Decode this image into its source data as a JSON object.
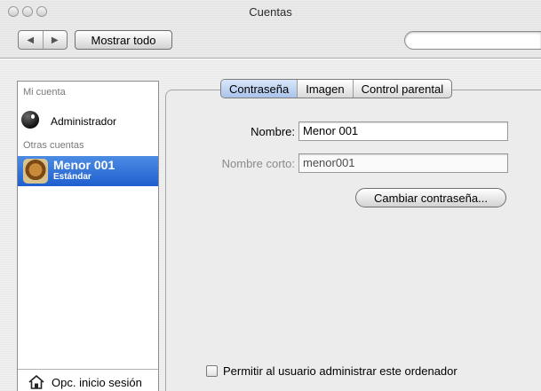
{
  "window": {
    "title": "Cuentas"
  },
  "toolbar": {
    "back_icon": "◀",
    "forward_icon": "▶",
    "show_all_label": "Mostrar todo",
    "search": {
      "value": "",
      "placeholder": ""
    }
  },
  "sidebar": {
    "my_account_header": "Mi cuenta",
    "admin_account": {
      "name": "Administrador",
      "icon": "admin-avatar"
    },
    "other_accounts_header": "Otras cuentas",
    "selected_account": {
      "name": "Menor 001",
      "type": "Estándar",
      "icon": "cat-avatar"
    },
    "login_options_label": "Opc. inicio sesión"
  },
  "tabs": [
    {
      "label": "Contraseña",
      "active": true
    },
    {
      "label": "Imagen",
      "active": false
    },
    {
      "label": "Control parental",
      "active": false
    }
  ],
  "form": {
    "name_label": "Nombre:",
    "name_value": "Menor 001",
    "short_name_label": "Nombre corto:",
    "short_name_value": "menor001",
    "change_password_label": "Cambiar contraseña...",
    "allow_admin_label": "Permitir al usuario administrar este ordenador",
    "allow_admin_checked": false
  },
  "colors": {
    "selection": "#1e5fcf",
    "active_tab": "#a9c3ea"
  }
}
